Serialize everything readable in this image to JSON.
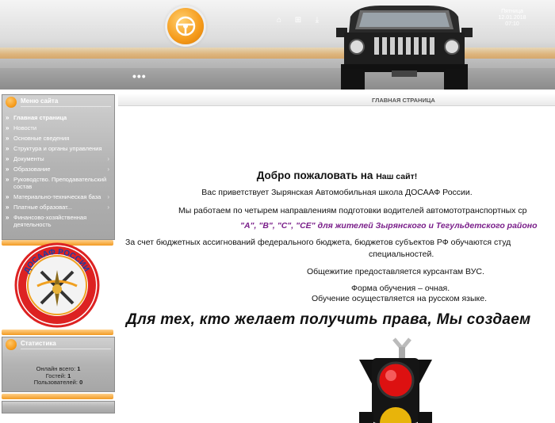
{
  "header": {
    "dots": "•••",
    "date": {
      "day": "Пятница",
      "date": "12.01.2018",
      "time": "07:10"
    },
    "icons": [
      "home-icon",
      "bookmark-icon",
      "download-icon"
    ]
  },
  "sidebar": {
    "menu_title": "Меню сайта",
    "items": [
      {
        "label": "Главная страница",
        "active": true,
        "arrow": ""
      },
      {
        "label": "Новости",
        "arrow": ""
      },
      {
        "label": "Основные сведения",
        "arrow": ""
      },
      {
        "label": "Структура и органы управления",
        "arrow": ""
      },
      {
        "label": "Документы",
        "arrow": "›"
      },
      {
        "label": "Образование",
        "arrow": "›"
      },
      {
        "label": "Руководство. Преподавательский состав",
        "arrow": ""
      },
      {
        "label": "Материально-техническая база",
        "arrow": "›"
      },
      {
        "label": "Платные образоват...",
        "arrow": "›"
      },
      {
        "label": "Финансово-хозяйственная деятельность",
        "arrow": ""
      }
    ],
    "stats_title": "Статистика",
    "stats": {
      "online_label": "Онлайн всего:",
      "online": "1",
      "guests_label": "Гостей:",
      "guests": "1",
      "users_label": "Пользователей:",
      "users": "0"
    },
    "emblem_text": "ДОСААФ РОССИИ"
  },
  "main": {
    "breadcrumb": "ГЛАВНАЯ СТРАНИЦА",
    "welcome": "Добро пожаловать на",
    "welcome_small": "Наш сайт!",
    "line1": "Вас приветствует Зырянская Автомобильная школа ДОСААФ России.",
    "line2": "Мы работаем по четырем направлениям подготовки водителей автомототранспортных ср",
    "line3": "\"А\", \"В\", \"С\", \"СЕ\" для жителей Зырянского и Тегульдетского районо",
    "line4": "За счет  бюджетных ассигнований  федерального бюджета, бюджетов субъектов РФ  обучаются студ",
    "line5": "специальностей.",
    "line6": "Общежитие предоставляется курсантам ВУС.",
    "line7": "Форма обучения – очная.",
    "line8": "Обучение осуществляется на русском языке.",
    "slogan": "Для тех, кто желает получить права, Мы создаем"
  },
  "colors": {
    "accent": "#f29a22",
    "panel": "#b3b3b3",
    "highlight": "#7a1f8a"
  }
}
